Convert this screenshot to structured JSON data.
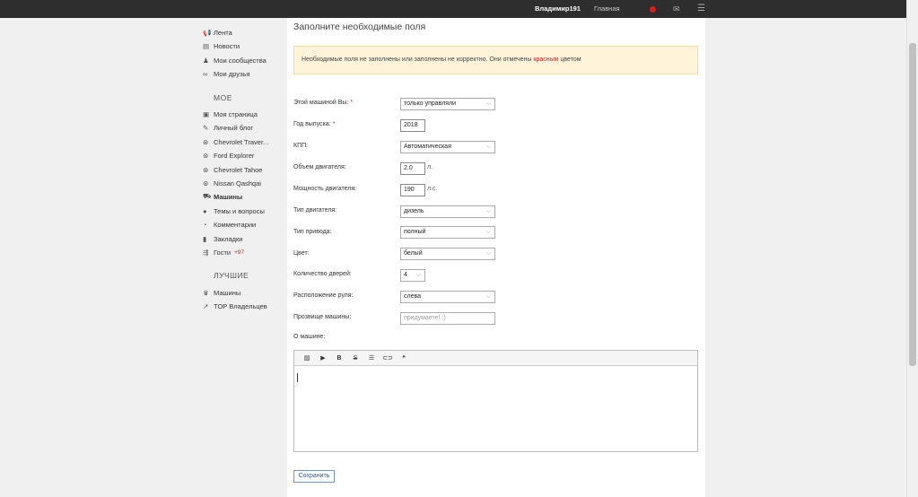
{
  "topbar": {
    "username": "Владимир191",
    "home_link": "Главная"
  },
  "sidebar": {
    "items": [
      {
        "icon": "megaphone-icon",
        "label": "Лента"
      },
      {
        "icon": "newspaper-icon",
        "label": "Новости"
      },
      {
        "icon": "community-icon",
        "label": "Мои сообщества"
      },
      {
        "icon": "friends-icon",
        "label": "Мои друзья"
      }
    ],
    "section_mine": "МОЕ",
    "mine_items": [
      {
        "icon": "page-icon",
        "label": "Моя страница"
      },
      {
        "icon": "pen-icon",
        "label": "Личный блог"
      },
      {
        "icon": "steering-wheel-icon",
        "label": "Chevrolet Traver..."
      },
      {
        "icon": "steering-wheel-icon",
        "label": "Ford Explorer"
      },
      {
        "icon": "steering-wheel-icon",
        "label": "Chevrolet Tahoe"
      },
      {
        "icon": "steering-wheel-icon",
        "label": "Nissan Qashqai"
      },
      {
        "icon": "car-icon",
        "label": "Машины"
      },
      {
        "icon": "chat-icon",
        "label": "Темы и вопросы"
      },
      {
        "icon": "comment-icon",
        "label": "Комментарии"
      },
      {
        "icon": "bookmark-icon",
        "label": "Закладки"
      },
      {
        "icon": "guests-icon",
        "label": "Гости",
        "count": "+97"
      }
    ],
    "section_best": "ЛУЧШИЕ",
    "best_items": [
      {
        "icon": "trophy-icon",
        "label": "Машины"
      },
      {
        "icon": "trend-icon",
        "label": "TOP Владельцев"
      }
    ]
  },
  "form": {
    "title": "Заполните необходимые поля",
    "alert_text": "Необходимые поля не заполнены или заполнены не корректно. Они отмечены",
    "alert_red": "красным",
    "alert_tail": "цветом",
    "fields": {
      "ownership": {
        "label": "Этой машиной Вы:",
        "required": "*",
        "value": "только управляли"
      },
      "year": {
        "label": "Год выпуска:",
        "required": "*",
        "value": "2018"
      },
      "gearbox": {
        "label": "КПП:",
        "value": "Автоматическая"
      },
      "engine_volume": {
        "label": "Объем двигателя:",
        "value": "2.0",
        "unit": "л."
      },
      "power": {
        "label": "Мощность двигателя:",
        "value": "190",
        "unit": "л.с."
      },
      "engine_type": {
        "label": "Тип двигателя:",
        "value": "дизель"
      },
      "drive": {
        "label": "Тип привода:",
        "value": "полный"
      },
      "color": {
        "label": "Цвет:",
        "value": "белый"
      },
      "doors": {
        "label": "Количество дверей:",
        "value": "4"
      },
      "wheel": {
        "label": "Расположение руля:",
        "value": "слева"
      },
      "nickname": {
        "label": "Прозвище машины:",
        "placeholder": "придумаете! :)"
      },
      "about": {
        "label": "О машине:"
      }
    },
    "editor_tools": [
      "image-icon",
      "video-icon",
      "bold-icon",
      "strike-icon",
      "list-icon",
      "link-icon",
      "quote-icon"
    ],
    "save_label": "Сохранить"
  },
  "colors": {
    "accent_red": "#d42020",
    "alert_bg": "#fff4d9",
    "topbar_bg": "#2e2e2e"
  }
}
